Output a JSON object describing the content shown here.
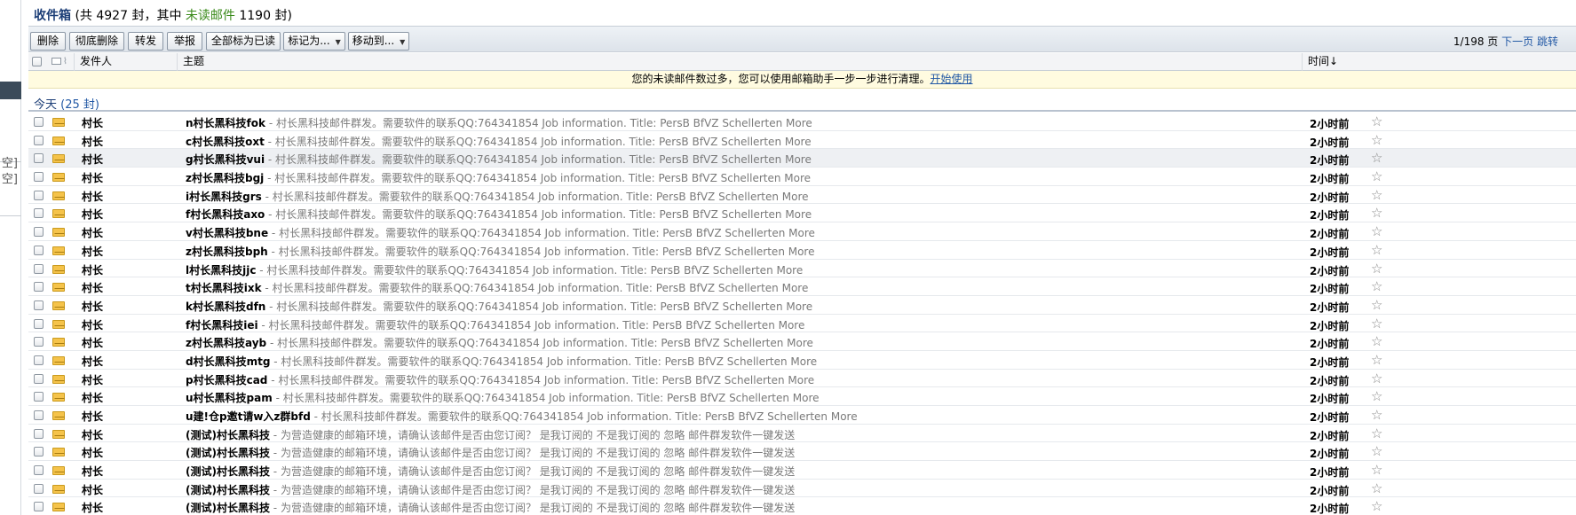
{
  "left_fragments": [
    "空]",
    "空]"
  ],
  "header": {
    "title": "收件箱",
    "prefix": "(共 4927 封，其中",
    "unread_label": "未读邮件",
    "suffix": "1190 封)"
  },
  "toolbar": {
    "delete": "删除",
    "delete_forever": "彻底删除",
    "forward": "转发",
    "report": "举报",
    "mark_all_read": "全部标为已读",
    "mark_as": "标记为...",
    "move_to": "移动到..."
  },
  "pager": {
    "page": "1/198 页",
    "next": "下一页",
    "jump": "跳转"
  },
  "columns": {
    "sender": "发件人",
    "subject": "主题",
    "time": "时间↓"
  },
  "tip": {
    "text": "您的未读邮件数过多，您可以使用邮箱助手一步一步进行清理。",
    "link": "开始使用"
  },
  "group": {
    "label": "今天",
    "count": "(25 封)"
  },
  "rows": [
    {
      "sender": "村长",
      "subject": "n村长黑科技fok",
      "summary": " - 村长黑科技邮件群发。需要软件的联系QQ:764341854 Job information. Title: PersB BfVZ Schellerten More",
      "time": "2小时前"
    },
    {
      "sender": "村长",
      "subject": "c村长黑科技oxt",
      "summary": " - 村长黑科技邮件群发。需要软件的联系QQ:764341854 Job information. Title: PersB BfVZ Schellerten More",
      "time": "2小时前"
    },
    {
      "sender": "村长",
      "subject": "g村长黑科技vui",
      "summary": " - 村长黑科技邮件群发。需要软件的联系QQ:764341854 Job information. Title: PersB BfVZ Schellerten More",
      "time": "2小时前"
    },
    {
      "sender": "村长",
      "subject": "z村长黑科技bgj",
      "summary": " - 村长黑科技邮件群发。需要软件的联系QQ:764341854 Job information. Title: PersB BfVZ Schellerten More",
      "time": "2小时前"
    },
    {
      "sender": "村长",
      "subject": "i村长黑科技grs",
      "summary": " - 村长黑科技邮件群发。需要软件的联系QQ:764341854 Job information. Title: PersB BfVZ Schellerten More",
      "time": "2小时前"
    },
    {
      "sender": "村长",
      "subject": "f村长黑科技axo",
      "summary": " - 村长黑科技邮件群发。需要软件的联系QQ:764341854 Job information. Title: PersB BfVZ Schellerten More",
      "time": "2小时前"
    },
    {
      "sender": "村长",
      "subject": "v村长黑科技bne",
      "summary": " - 村长黑科技邮件群发。需要软件的联系QQ:764341854 Job information. Title: PersB BfVZ Schellerten More",
      "time": "2小时前"
    },
    {
      "sender": "村长",
      "subject": "z村长黑科技bph",
      "summary": " - 村长黑科技邮件群发。需要软件的联系QQ:764341854 Job information. Title: PersB BfVZ Schellerten More",
      "time": "2小时前"
    },
    {
      "sender": "村长",
      "subject": "l村长黑科技jjc",
      "summary": " - 村长黑科技邮件群发。需要软件的联系QQ:764341854 Job information. Title: PersB BfVZ Schellerten More",
      "time": "2小时前"
    },
    {
      "sender": "村长",
      "subject": "t村长黑科技ixk",
      "summary": " - 村长黑科技邮件群发。需要软件的联系QQ:764341854 Job information. Title: PersB BfVZ Schellerten More",
      "time": "2小时前"
    },
    {
      "sender": "村长",
      "subject": "k村长黑科技dfn",
      "summary": " - 村长黑科技邮件群发。需要软件的联系QQ:764341854 Job information. Title: PersB BfVZ Schellerten More",
      "time": "2小时前"
    },
    {
      "sender": "村长",
      "subject": "f村长黑科技iei",
      "summary": " - 村长黑科技邮件群发。需要软件的联系QQ:764341854 Job information. Title: PersB BfVZ Schellerten More",
      "time": "2小时前"
    },
    {
      "sender": "村长",
      "subject": "z村长黑科技ayb",
      "summary": " - 村长黑科技邮件群发。需要软件的联系QQ:764341854 Job information. Title: PersB BfVZ Schellerten More",
      "time": "2小时前"
    },
    {
      "sender": "村长",
      "subject": "d村长黑科技mtg",
      "summary": " - 村长黑科技邮件群发。需要软件的联系QQ:764341854 Job information. Title: PersB BfVZ Schellerten More",
      "time": "2小时前"
    },
    {
      "sender": "村长",
      "subject": "p村长黑科技cad",
      "summary": " - 村长黑科技邮件群发。需要软件的联系QQ:764341854 Job information. Title: PersB BfVZ Schellerten More",
      "time": "2小时前"
    },
    {
      "sender": "村长",
      "subject": "u村长黑科技pam",
      "summary": " - 村长黑科技邮件群发。需要软件的联系QQ:764341854 Job information. Title: PersB BfVZ Schellerten More",
      "time": "2小时前"
    },
    {
      "sender": "村长",
      "subject": "u建!仓p邀t请w入z群bfd",
      "summary": " - 村长黑科技邮件群发。需要软件的联系QQ:764341854 Job information. Title: PersB BfVZ Schellerten More",
      "time": "2小时前"
    },
    {
      "sender": "村长",
      "subject": "(测试)村长黑科技",
      "summary": " - 为营造健康的邮箱环境，请确认该邮件是否由您订阅？ 是我订阅的 不是我订阅的 忽略 邮件群发软件一键发送",
      "time": "2小时前"
    },
    {
      "sender": "村长",
      "subject": "(测试)村长黑科技",
      "summary": " - 为营造健康的邮箱环境，请确认该邮件是否由您订阅？ 是我订阅的 不是我订阅的 忽略 邮件群发软件一键发送",
      "time": "2小时前"
    },
    {
      "sender": "村长",
      "subject": "(测试)村长黑科技",
      "summary": " - 为营造健康的邮箱环境，请确认该邮件是否由您订阅？ 是我订阅的 不是我订阅的 忽略 邮件群发软件一键发送",
      "time": "2小时前"
    },
    {
      "sender": "村长",
      "subject": "(测试)村长黑科技",
      "summary": " - 为营造健康的邮箱环境，请确认该邮件是否由您订阅？ 是我订阅的 不是我订阅的 忽略 邮件群发软件一键发送",
      "time": "2小时前"
    },
    {
      "sender": "村长",
      "subject": "(测试)村长黑科技",
      "summary": " - 为营造健康的邮箱环境，请确认该邮件是否由您订阅？ 是我订阅的 不是我订阅的 忽略 邮件群发软件一键发送",
      "time": "2小时前"
    }
  ]
}
